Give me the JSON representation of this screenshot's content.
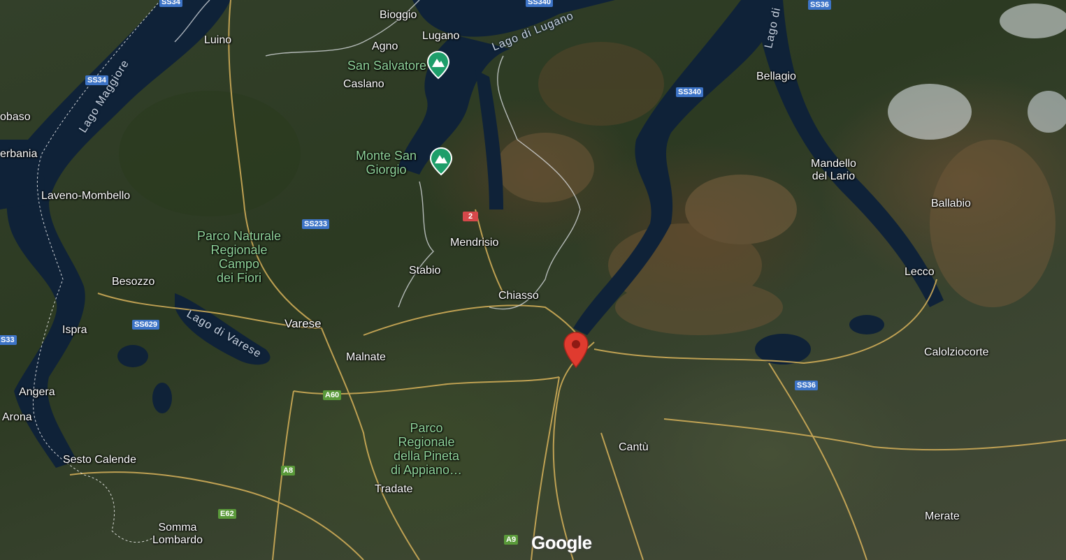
{
  "map": {
    "type": "satellite",
    "attribution": "Google",
    "marker": {
      "name": "red-location-pin",
      "color": "#d93025"
    }
  },
  "cities": [
    {
      "id": "bioggio",
      "text": "Bioggio"
    },
    {
      "id": "lugano",
      "text": "Lugano"
    },
    {
      "id": "agno",
      "text": "Agno"
    },
    {
      "id": "luino",
      "text": "Luino"
    },
    {
      "id": "caslano",
      "text": "Caslano"
    },
    {
      "id": "bellagio",
      "text": "Bellagio"
    },
    {
      "id": "mandello",
      "text": "Mandello\ndel Lario"
    },
    {
      "id": "ballabio",
      "text": "Ballabio"
    },
    {
      "id": "lecco",
      "text": "Lecco"
    },
    {
      "id": "calolziocorte",
      "text": "Calolziocorte"
    },
    {
      "id": "mendrisio",
      "text": "Mendrisio"
    },
    {
      "id": "stabio",
      "text": "Stabio"
    },
    {
      "id": "chiasso",
      "text": "Chiasso"
    },
    {
      "id": "varese",
      "text": "Varese"
    },
    {
      "id": "malnate",
      "text": "Malnate"
    },
    {
      "id": "besozzo",
      "text": "Besozzo"
    },
    {
      "id": "ispra",
      "text": "Ispra"
    },
    {
      "id": "angera",
      "text": "Angera"
    },
    {
      "id": "arona",
      "text": "Arona"
    },
    {
      "id": "sesto",
      "text": "Sesto Calende"
    },
    {
      "id": "somma",
      "text": "Somma\nLombardo"
    },
    {
      "id": "tradate",
      "text": "Tradate"
    },
    {
      "id": "cantu",
      "text": "Cantù"
    },
    {
      "id": "merate",
      "text": "Merate"
    },
    {
      "id": "laveno",
      "text": "Laveno-Mombello"
    },
    {
      "id": "verbania",
      "text": "erbania"
    },
    {
      "id": "cambiasca",
      "text": "obaso"
    }
  ],
  "parks": [
    {
      "id": "campo",
      "text": "Parco Naturale\nRegionale\nCampo\ndei Fiori"
    },
    {
      "id": "appiano",
      "text": "Parco\nRegionale\ndella Pineta\ndi Appiano…"
    }
  ],
  "pois": [
    {
      "id": "salvatore",
      "text": "San Salvatore",
      "icon": "mountain-icon"
    },
    {
      "id": "giorgio",
      "text": "Monte San\nGiorgio",
      "icon": "mountain-icon"
    }
  ],
  "water": [
    {
      "id": "maggiore",
      "text": "Lago Maggiore"
    },
    {
      "id": "lugano_lake",
      "text": "Lago di Lugano"
    },
    {
      "id": "varese_lake",
      "text": "Lago di Varese"
    },
    {
      "id": "como",
      "text": "Lago di"
    }
  ],
  "roads": [
    {
      "id": "ss34a",
      "text": "SS34",
      "color": "blue"
    },
    {
      "id": "ss34b",
      "text": "SS34",
      "color": "blue"
    },
    {
      "id": "ss340a",
      "text": "SS340",
      "color": "blue"
    },
    {
      "id": "ss340b",
      "text": "SS340",
      "color": "blue"
    },
    {
      "id": "ss36a",
      "text": "SS36",
      "color": "blue"
    },
    {
      "id": "ss36b",
      "text": "SS36",
      "color": "blue"
    },
    {
      "id": "ss233",
      "text": "SS233",
      "color": "blue"
    },
    {
      "id": "ss629",
      "text": "SS629",
      "color": "blue"
    },
    {
      "id": "ss33",
      "text": "S33",
      "color": "blue"
    },
    {
      "id": "r2",
      "text": "2",
      "color": "red"
    },
    {
      "id": "a60",
      "text": "A60",
      "color": "green"
    },
    {
      "id": "a8",
      "text": "A8",
      "color": "green"
    },
    {
      "id": "e62",
      "text": "E62",
      "color": "green"
    },
    {
      "id": "a9",
      "text": "A9",
      "color": "green"
    }
  ]
}
